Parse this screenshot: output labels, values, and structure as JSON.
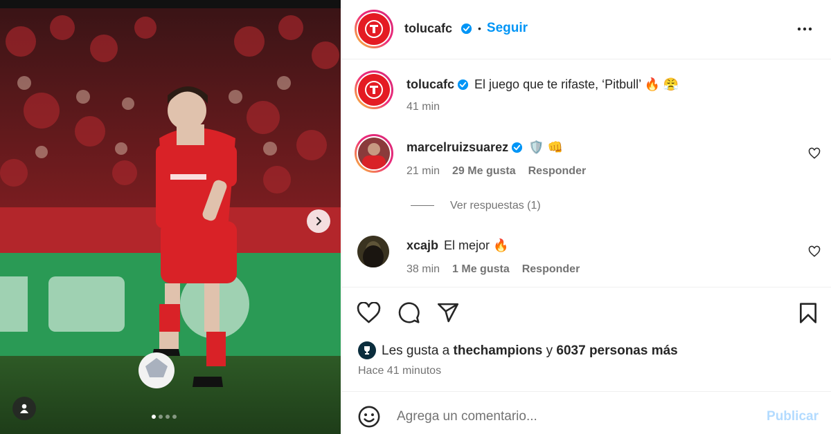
{
  "post": {
    "account": "tolucafc",
    "follow_label": "Seguir",
    "separator": "•",
    "caption": "El juego que te rifaste, ‘Pitbull’ 🔥 😤",
    "caption_time": "41 min"
  },
  "comments": [
    {
      "user": "marcelruizsuarez",
      "text": "🛡️ 👊",
      "time": "21 min",
      "likes": "29 Me gusta",
      "reply_label": "Responder",
      "view_replies": "Ver respuestas (1)"
    },
    {
      "user": "xcajb",
      "text": "El mejor 🔥",
      "time": "38 min",
      "likes": "1 Me gusta",
      "reply_label": "Responder"
    }
  ],
  "likes_summary": {
    "prefix": "Les gusta a",
    "user": "thechampions",
    "joiner": "y",
    "others": "6037 personas más"
  },
  "post_time": "Hace 41 minutos",
  "composer": {
    "placeholder": "Agrega un comentario...",
    "publish_label": "Publicar"
  },
  "carousel": {
    "total": 4,
    "active": 1
  },
  "colors": {
    "accent": "#0095f6",
    "brand": "#e41b23",
    "publish_disabled": "#b3dbff"
  }
}
